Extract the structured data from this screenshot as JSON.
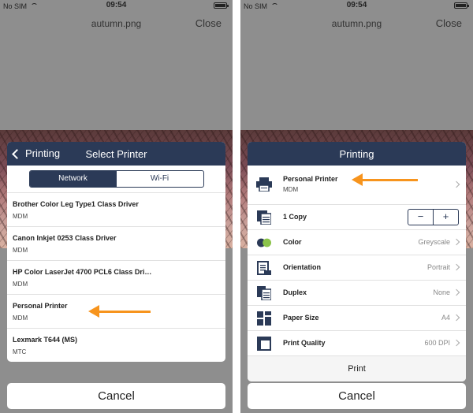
{
  "status": {
    "carrier": "No SIM",
    "time": "09:54"
  },
  "navbar": {
    "filename": "autumn.png",
    "close_label": "Close"
  },
  "select_printer": {
    "back_label": "Printing",
    "title": "Select Printer",
    "tabs": [
      {
        "label": "Network",
        "active": true
      },
      {
        "label": "Wi-Fi",
        "active": false
      }
    ],
    "printers": [
      {
        "name": "Brother Color Leg Type1 Class Driver",
        "type": "MDM"
      },
      {
        "name": "Canon Inkjet 0253 Class Driver",
        "type": "MDM"
      },
      {
        "name": "HP Color LaserJet 4700 PCL6 Class Dri…",
        "type": "MDM"
      },
      {
        "name": "Personal Printer",
        "type": "MDM"
      },
      {
        "name": "Lexmark T644 (MS)",
        "type": "MTC"
      }
    ]
  },
  "printing": {
    "title": "Printing",
    "printer": {
      "name": "Personal Printer",
      "type": "MDM"
    },
    "copies_label": "1 Copy",
    "stepper": {
      "minus": "−",
      "plus": "+"
    },
    "settings": [
      {
        "label": "Color",
        "value": "Greyscale"
      },
      {
        "label": "Orientation",
        "value": "Portrait"
      },
      {
        "label": "Duplex",
        "value": "None"
      },
      {
        "label": "Paper Size",
        "value": "A4"
      },
      {
        "label": "Print Quality",
        "value": "600 DPI"
      }
    ],
    "print_label": "Print"
  },
  "cancel_label": "Cancel",
  "colors": {
    "header": "#2b3a57",
    "arrow": "#f7941d"
  }
}
